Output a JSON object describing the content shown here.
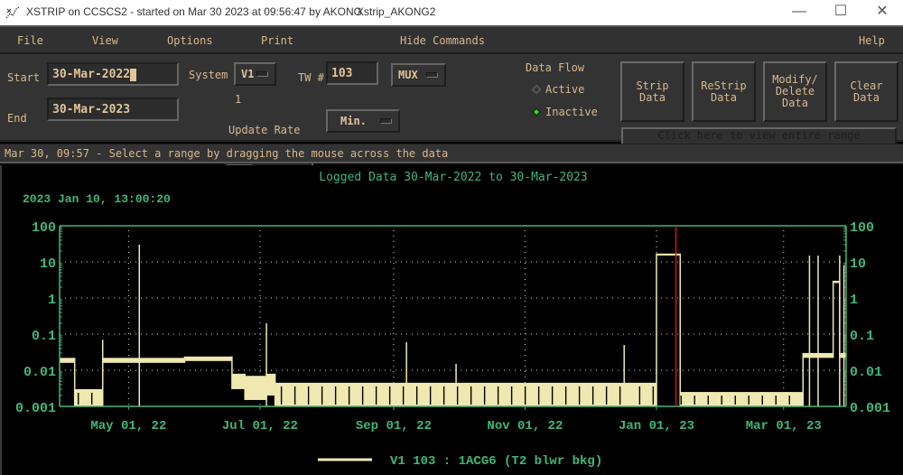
{
  "window": {
    "title": "XSTRIP on CCSCS2 - started on Mar 30 2023 at 09:56:47 by AKONG",
    "subtitle": "Xstrip_AKONG2",
    "controls": {
      "minimize": "—",
      "maximize": "☐",
      "close": "✕"
    }
  },
  "menu": {
    "file": "File",
    "view": "View",
    "options": "Options",
    "print": "Print",
    "hide_commands": "Hide Commands",
    "help": "Help"
  },
  "controls": {
    "start_label": "Start",
    "start_value": "30-Mar-2022",
    "end_label": "End",
    "end_value": "30-Mar-2023",
    "system_label": "System",
    "system_value": "V1",
    "tw_label": "TW #",
    "tw_value": "103",
    "mux_value": "MUX",
    "update_rate_value": "1",
    "update_rate_label": "Update Rate",
    "update_rate_fraction": 0.0,
    "units_value": "Min.",
    "data_flow_label": "Data Flow",
    "data_flow_options": [
      "Active",
      "Inactive"
    ],
    "data_flow_selected": "Inactive",
    "buttons": {
      "strip": "Strip\nData",
      "restrip": "ReStrip\nData",
      "modify": "Modify/\nDelete\nData",
      "clear": "Clear\nData"
    },
    "range_button": "Click here to view entire range"
  },
  "status": {
    "text": "Mar 30, 09:57 -  Select a range by dragging the mouse across the data"
  },
  "colors": {
    "panel": "#333333",
    "text_tan": "#d8b98f",
    "plot_green": "#3fb77a",
    "trace": "#efe8b0",
    "cursor_red": "#e01010",
    "indicator_green": "#1cf01c"
  },
  "chart_data": {
    "type": "line",
    "title": "Logged Data  30-Mar-2022 to 30-Mar-2023",
    "cursor_label": "2023 Jan 10, 13:00:20",
    "cursor_x": "2023-01-10",
    "yscale": "log",
    "ylim": [
      0.001,
      100
    ],
    "xlim": [
      "2022-03-30",
      "2023-03-30"
    ],
    "y_ticks": [
      "100",
      "10",
      "1",
      "0.1",
      "0.01",
      "0.001"
    ],
    "x_ticks": [
      {
        "date": "2022-05-01",
        "label": "May 01, 22"
      },
      {
        "date": "2022-07-01",
        "label": "Jul 01, 22"
      },
      {
        "date": "2022-09-01",
        "label": "Sep 01, 22"
      },
      {
        "date": "2022-11-01",
        "label": "Nov 01, 22"
      },
      {
        "date": "2023-01-01",
        "label": "Jan 01, 23"
      },
      {
        "date": "2023-03-01",
        "label": "Mar 01, 23"
      }
    ],
    "grid": true,
    "legend": "bottom-center",
    "series": [
      {
        "name": "V1 103 : 1ACG6 (T2 blwr bkg)",
        "segments": [
          {
            "from": "2022-03-30",
            "to": "2022-04-06",
            "hi": 0.022,
            "lo": 0.016
          },
          {
            "from": "2022-04-06",
            "to": "2022-04-19",
            "hi": 0.003,
            "lo": 0.001
          },
          {
            "from": "2022-04-19",
            "to": "2022-05-27",
            "hi": 0.022,
            "lo": 0.016
          },
          {
            "from": "2022-05-27",
            "to": "2022-06-18",
            "hi": 0.024,
            "lo": 0.018
          },
          {
            "from": "2022-06-18",
            "to": "2022-06-24",
            "hi": 0.008,
            "lo": 0.003
          },
          {
            "from": "2022-06-24",
            "to": "2022-07-04",
            "hi": 0.007,
            "lo": 0.0015
          },
          {
            "from": "2022-07-04",
            "to": "2022-07-08",
            "hi": 0.008,
            "lo": 0.002
          },
          {
            "from": "2022-07-08",
            "to": "2022-12-20",
            "hi": 0.0045,
            "lo": 0.001
          },
          {
            "from": "2022-12-20",
            "to": "2023-01-01",
            "hi": 0.0045,
            "lo": 0.001
          },
          {
            "from": "2023-01-01",
            "to": "2023-01-12",
            "hi": 17,
            "lo": 15
          },
          {
            "from": "2023-01-12",
            "to": "2023-03-10",
            "hi": 0.0025,
            "lo": 0.001
          },
          {
            "from": "2023-03-10",
            "to": "2023-03-24",
            "hi": 0.03,
            "lo": 0.022
          },
          {
            "from": "2023-03-24",
            "to": "2023-03-27",
            "hi": 3,
            "lo": 2.6
          },
          {
            "from": "2023-03-27",
            "to": "2023-03-30",
            "hi": 0.03,
            "lo": 0.022
          }
        ],
        "spikes": [
          {
            "date": "2022-04-19",
            "value": 0.07
          },
          {
            "date": "2022-05-06",
            "value": 30
          },
          {
            "date": "2022-07-04",
            "value": 0.2
          },
          {
            "date": "2022-09-07",
            "value": 0.06
          },
          {
            "date": "2022-09-30",
            "value": 0.015
          },
          {
            "date": "2022-12-17",
            "value": 0.05
          },
          {
            "date": "2023-03-13",
            "value": 15
          },
          {
            "date": "2023-03-17",
            "value": 15
          },
          {
            "date": "2023-03-27",
            "value": 15
          },
          {
            "date": "2023-03-29",
            "value": 8
          }
        ]
      }
    ]
  }
}
